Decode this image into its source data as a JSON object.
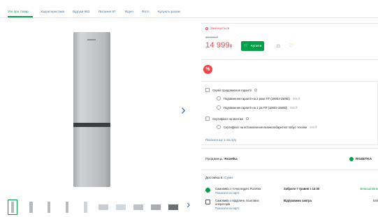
{
  "tabs": [
    {
      "label": "Усе про товар",
      "active": true
    },
    {
      "label": "Характеристики",
      "active": false
    },
    {
      "label": "Відгуки 983",
      "active": false
    },
    {
      "label": "Питання 97",
      "active": false
    },
    {
      "label": "Відео",
      "active": false
    },
    {
      "label": "Фото",
      "active": false
    },
    {
      "label": "Купують разом",
      "active": false
    }
  ],
  "gallery": {
    "next_icon": "chevron-right-icon",
    "thumbs_count": 10,
    "thumbs_next_icon": "chevron-right-icon"
  },
  "status": {
    "badge": "Закінчується",
    "old_price": "16 999 ₴",
    "price_value": "14 999",
    "price_currency": "₴",
    "buy_label": "Купити",
    "cart_icon": "cart-icon",
    "compare_icon": "compare-scales-icon",
    "wishlist_icon": "heart-icon"
  },
  "promo": {
    "icon_text": "%",
    "icon": "percent-icon"
  },
  "services": {
    "warranty_title": "Сервіс продовження гарантії",
    "options": [
      {
        "label": "Подовження гарантії на 2 роки ПТ (10001-15000)",
        "price": "959 ₴"
      },
      {
        "label": "Подовження гарантії на 1 рік ПТ (10001-15000)",
        "price": "959 ₴"
      }
    ],
    "install_title": "Сертифікат на монтаж",
    "install_option": {
      "label": "Сертифікат на встановлення великогабаритної побут. техніки",
      "price": "399 ₴"
    },
    "more_link": "Показати ще 1 послугу"
  },
  "seller": {
    "label": "Продавець:",
    "name": "Rozetka",
    "logo_text": "ROZETKA"
  },
  "delivery": {
    "title": "Доставка в",
    "city": "Суми",
    "rows": [
      {
        "name": "Самовивіз з точок видачі Rozetka",
        "map": "Показати на карті",
        "when": "Забрати 7 травня з 14:00",
        "cost": "Безкоштовно",
        "free": true,
        "icon": "rozetka-pickup-icon"
      },
      {
        "name": "Самовивіз з відділень поштових операторів",
        "map": "Показати на карті",
        "when": "Відправимо завтра",
        "cost": "540",
        "free": false,
        "icon": "post-office-icon"
      }
    ]
  },
  "colors": {
    "accent": "#00a046",
    "link": "#3e77aa",
    "price": "#f84147",
    "wishlist": "#ffa900"
  }
}
